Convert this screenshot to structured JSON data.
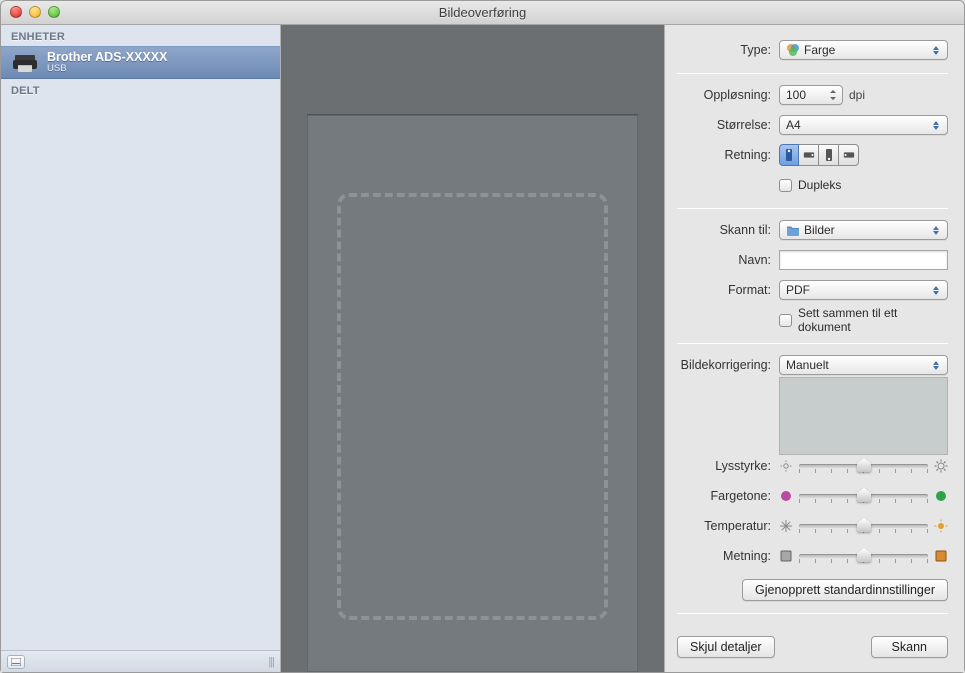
{
  "window": {
    "title": "Bildeoverføring"
  },
  "sidebar": {
    "groups": {
      "devices": "ENHETER",
      "shared": "DELT"
    },
    "device": {
      "name": "Brother ADS-XXXXX",
      "conn": "USB"
    }
  },
  "settings": {
    "type": {
      "label": "Type:",
      "value": "Farge"
    },
    "resolution": {
      "label": "Oppløsning:",
      "value": "100",
      "unit": "dpi"
    },
    "size": {
      "label": "Størrelse:",
      "value": "A4"
    },
    "orientation": {
      "label": "Retning:"
    },
    "duplex": {
      "label": "Dupleks"
    },
    "scanTo": {
      "label": "Skann til:",
      "value": "Bilder"
    },
    "name": {
      "label": "Navn:",
      "value": ""
    },
    "format": {
      "label": "Format:",
      "value": "PDF"
    },
    "combine": {
      "label": "Sett sammen til ett dokument"
    },
    "correction": {
      "label": "Bildekorrigering:",
      "value": "Manuelt"
    },
    "brightness": {
      "label": "Lysstyrke:"
    },
    "hue": {
      "label": "Fargetone:"
    },
    "temperature": {
      "label": "Temperatur:"
    },
    "saturation": {
      "label": "Metning:"
    },
    "reset": {
      "label": "Gjenopprett standardinnstillinger"
    }
  },
  "footer": {
    "hide": "Skjul detaljer",
    "scan": "Skann"
  }
}
